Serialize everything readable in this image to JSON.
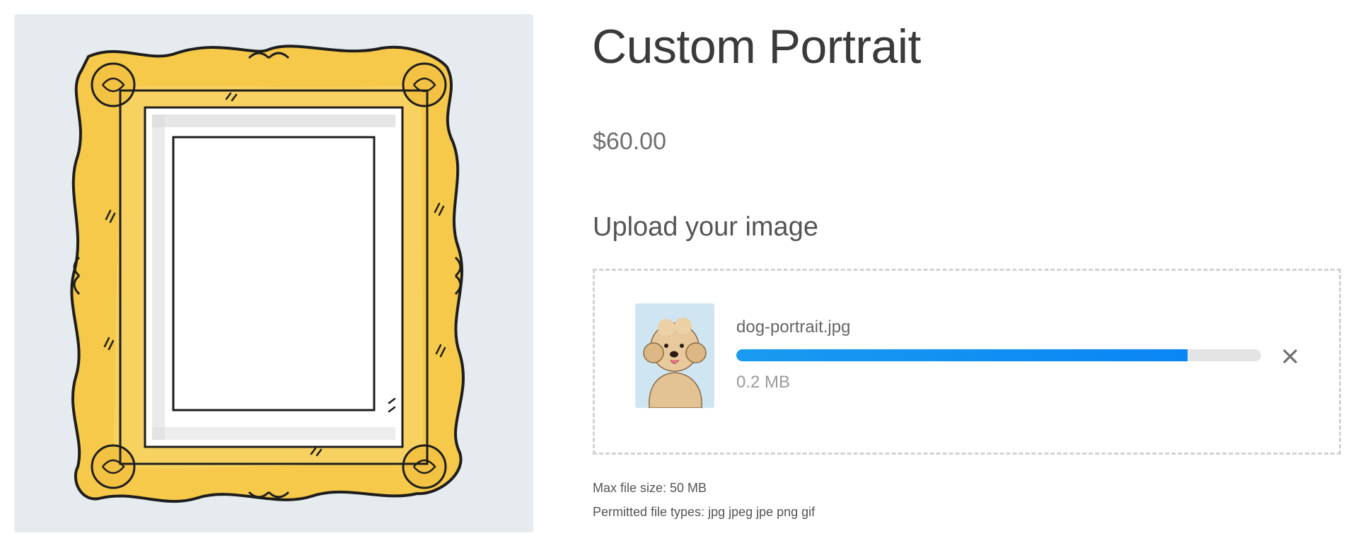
{
  "product": {
    "title": "Custom Portrait",
    "price": "$60.00",
    "image_icon": "ornate-gold-frame-illustration"
  },
  "upload": {
    "heading": "Upload your image",
    "file": {
      "name": "dog-portrait.jpg",
      "size": "0.2 MB",
      "thumbnail_icon": "dog-portrait-thumbnail",
      "progress_percent": 86
    },
    "remove_icon": "close-icon",
    "max_file_size": "Max file size: 50 MB",
    "permitted_types": "Permitted file types: jpg jpeg jpe png gif"
  },
  "colors": {
    "panel_background": "#e6ebef",
    "frame_gold": "#f6c94a",
    "progress_fill": "#0a85f5",
    "progress_track": "#e4e4e4",
    "dropzone_border": "#d2d2d2"
  }
}
